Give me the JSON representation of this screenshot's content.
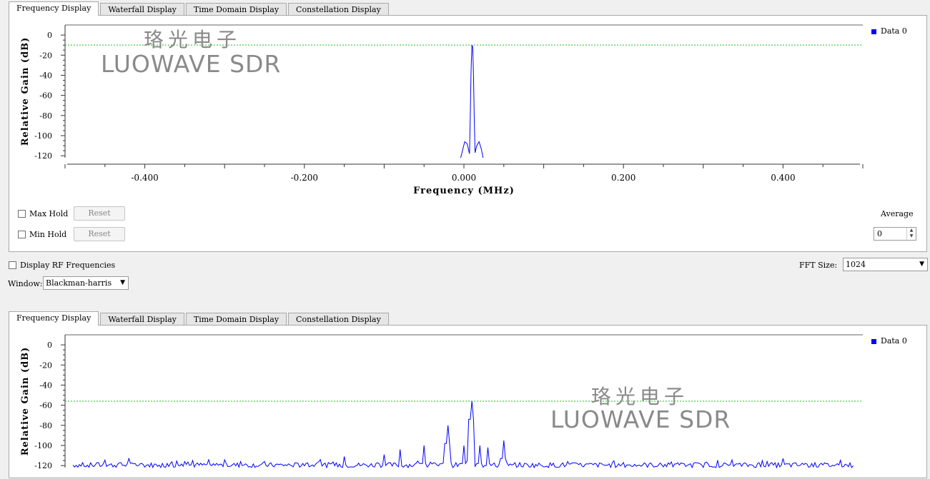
{
  "tabs": [
    "Frequency Display",
    "Waterfall Display",
    "Time Domain Display",
    "Constellation Display"
  ],
  "top_plot": {
    "ylabel": "Relative Gain (dB)",
    "xlabel": "Frequency (MHz)",
    "legend": "Data 0",
    "yticks": [
      "0",
      "-20",
      "-40",
      "-60",
      "-80",
      "-100",
      "-120"
    ],
    "xticks": [
      "-0.400",
      "-0.200",
      "0.000",
      "0.200",
      "0.400"
    ],
    "threshold_db": -10,
    "watermark_cn": "珞光电子",
    "watermark_en": "LUOWAVE SDR"
  },
  "controls": {
    "max_hold": "Max Hold",
    "min_hold": "Min Hold",
    "reset": "Reset",
    "average_label": "Average",
    "average_value": "0",
    "display_rf": "Display RF Frequencies",
    "fft_label": "FFT Size:",
    "fft_value": "1024",
    "window_label": "Window:",
    "window_value": "Blackman-harris"
  },
  "bottom_plot": {
    "ylabel": "Relative Gain (dB)",
    "legend": "Data 0",
    "yticks": [
      "0",
      "-20",
      "-40",
      "-60",
      "-80",
      "-100",
      "-120"
    ],
    "threshold_db": -56,
    "watermark_cn": "珞光电子",
    "watermark_en": "LUOWAVE SDR"
  },
  "colors": {
    "trace": "#0000ff",
    "threshold": "#22bb22"
  },
  "chart_data": [
    {
      "type": "line",
      "name": "top-spectrum",
      "xlabel": "Frequency (MHz)",
      "ylabel": "Relative Gain (dB)",
      "xlim": [
        -0.5,
        0.5
      ],
      "ylim": [
        -122,
        10
      ],
      "series": [
        {
          "name": "Data 0",
          "x": [
            -0.004,
            0.001,
            0.004,
            0.007,
            0.008,
            0.009,
            0.01,
            0.011,
            0.012,
            0.013,
            0.014,
            0.016,
            0.019,
            0.022,
            0.024
          ],
          "y": [
            -122,
            -106,
            -108,
            -118,
            -80,
            -35,
            -10,
            -12,
            -40,
            -85,
            -117,
            -110,
            -106,
            -114,
            -122
          ]
        }
      ],
      "threshold": -10
    },
    {
      "type": "line",
      "name": "bottom-spectrum",
      "ylabel": "Relative Gain (dB)",
      "ylim": [
        -122,
        10
      ],
      "series": [
        {
          "name": "Data 0",
          "peaks_x": [
            -0.46,
            -0.43,
            -0.42,
            -0.35,
            -0.34,
            -0.28,
            -0.25,
            -0.18,
            -0.15,
            -0.1,
            -0.08,
            -0.05,
            -0.02,
            0.0,
            0.01,
            0.02,
            0.03,
            0.05,
            0.07,
            0.13,
            0.2,
            0.29,
            0.4
          ],
          "peaks_y": [
            -117,
            -117,
            -113,
            -116,
            -115,
            -116,
            -116,
            -114,
            -111,
            -109,
            -104,
            -100,
            -80,
            -100,
            -56,
            -100,
            -102,
            -95,
            -117,
            -116,
            -117,
            -117,
            -113
          ]
        }
      ],
      "threshold": -56
    }
  ]
}
